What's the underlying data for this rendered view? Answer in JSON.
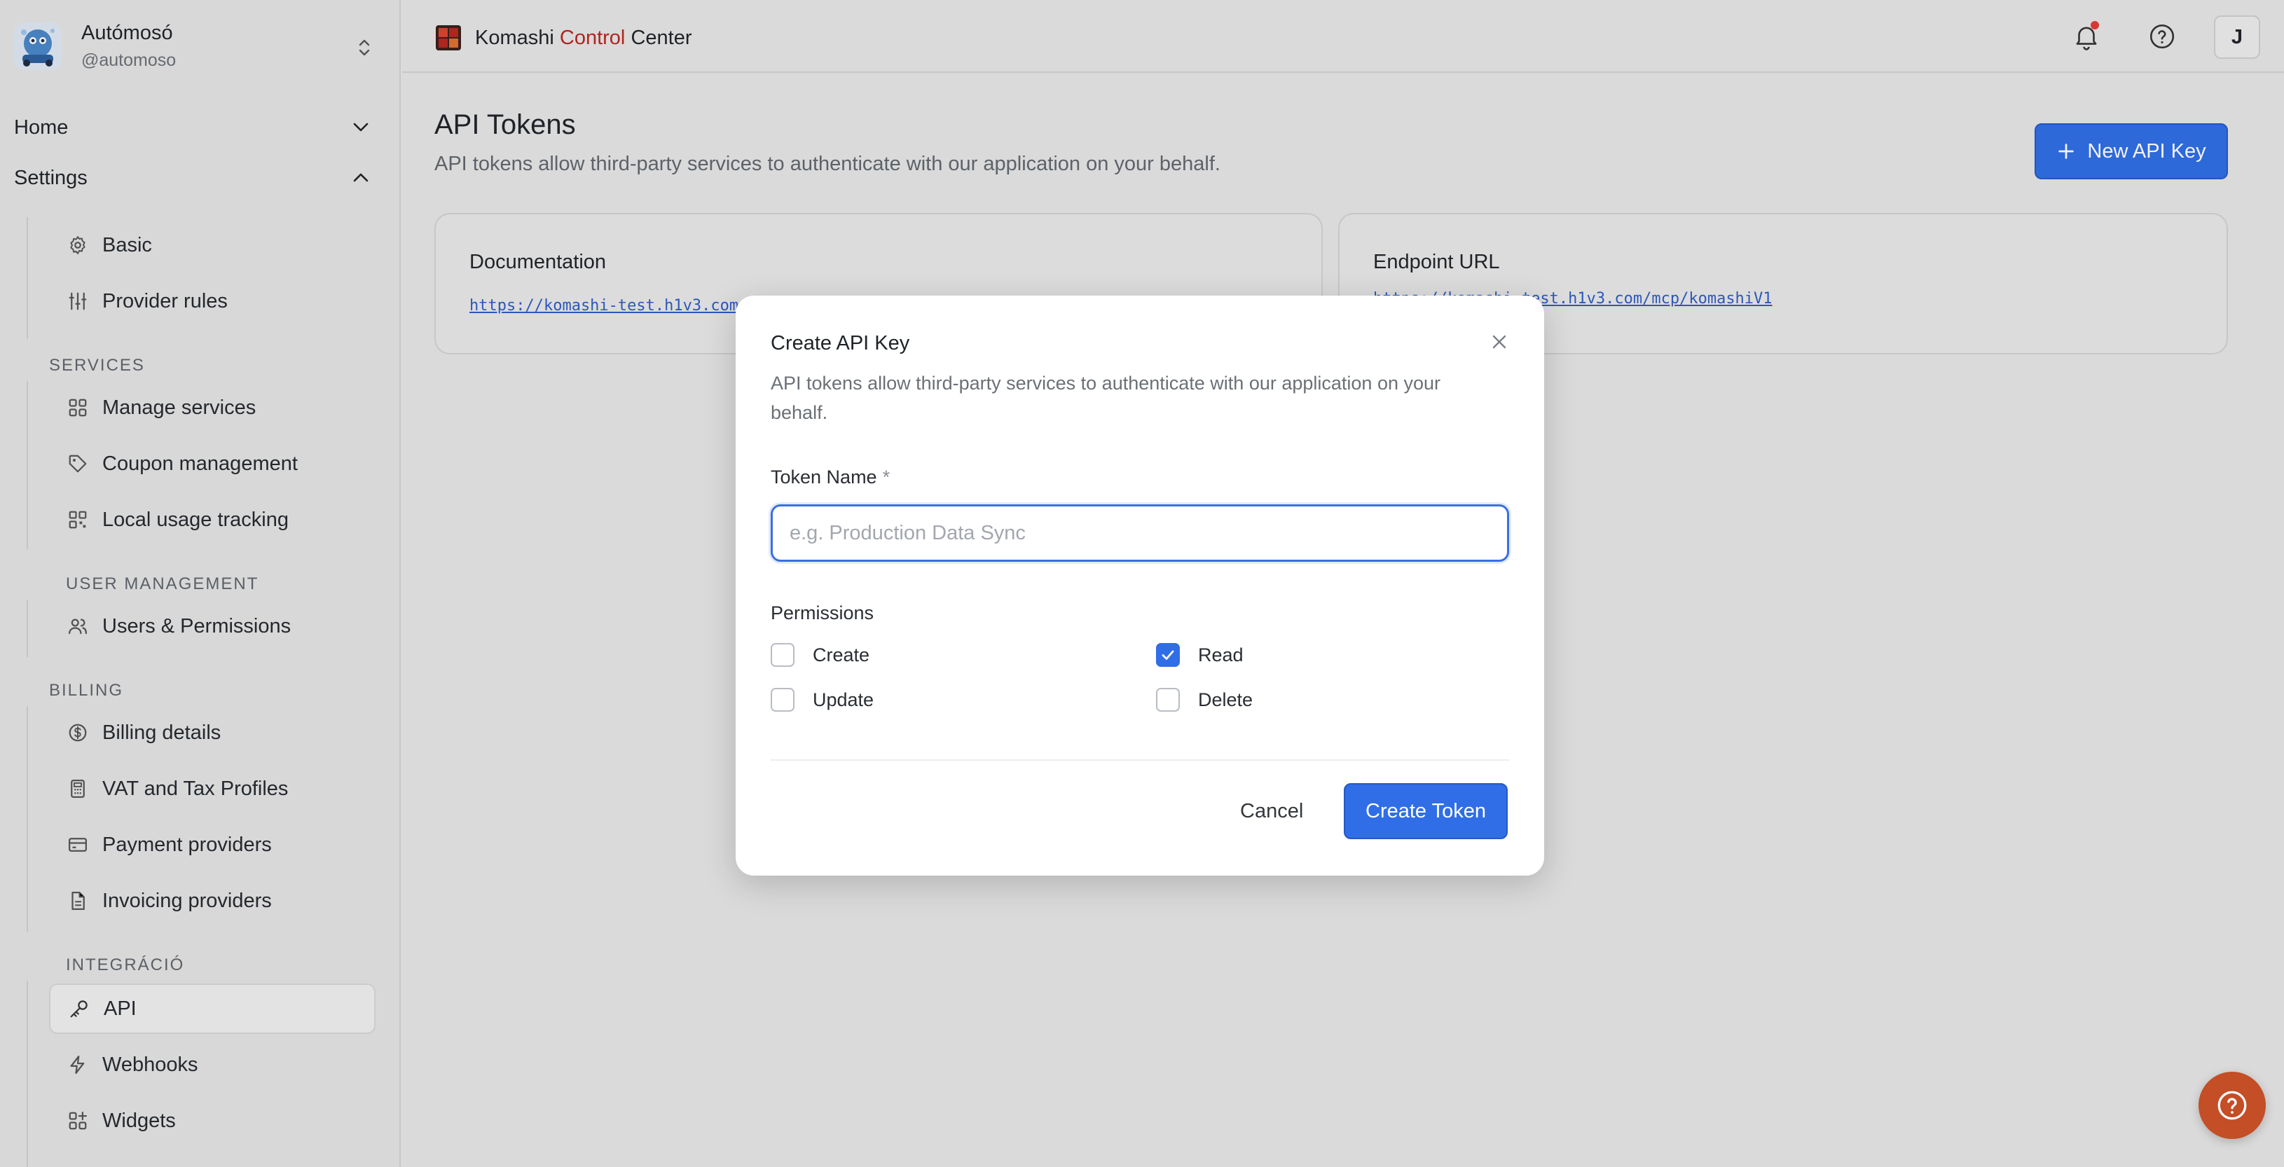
{
  "org": {
    "name": "Autómosó",
    "handle": "@automoso"
  },
  "sidebar": {
    "home_label": "Home",
    "settings_label": "Settings",
    "items_top": [
      {
        "label": "Basic",
        "icon": "gear-icon"
      },
      {
        "label": "Provider rules",
        "icon": "sliders-icon"
      }
    ],
    "sections": [
      {
        "title": "SERVICES",
        "items": [
          {
            "label": "Manage services",
            "icon": "grid-icon"
          },
          {
            "label": "Coupon management",
            "icon": "tag-icon"
          },
          {
            "label": "Local usage tracking",
            "icon": "qr-icon"
          }
        ]
      },
      {
        "title": "USER MANAGEMENT",
        "items": [
          {
            "label": "Users & Permissions",
            "icon": "users-icon"
          }
        ]
      },
      {
        "title": "BILLING",
        "items": [
          {
            "label": "Billing details",
            "icon": "dollar-circle-icon"
          },
          {
            "label": "VAT and Tax Profiles",
            "icon": "calculator-icon"
          },
          {
            "label": "Payment providers",
            "icon": "credit-card-icon"
          },
          {
            "label": "Invoicing providers",
            "icon": "file-icon"
          }
        ]
      },
      {
        "title": "INTEGRÁCIÓ",
        "items": [
          {
            "label": "API",
            "icon": "key-icon",
            "active": true
          },
          {
            "label": "Webhooks",
            "icon": "bolt-icon"
          },
          {
            "label": "Widgets",
            "icon": "widgets-icon"
          }
        ]
      }
    ]
  },
  "topbar": {
    "brand_part1": "Komashi",
    "brand_part2": "Control",
    "brand_part3": "Center",
    "avatar_initial": "J",
    "brand_red": "#b8261f"
  },
  "page": {
    "title": "API Tokens",
    "subtitle": "API tokens allow third-party services to authenticate with our application on your behalf.",
    "new_button": "New API Key",
    "cards": [
      {
        "title": "Documentation",
        "link": "https://komashi-test.h1v3.com/"
      },
      {
        "title": "Endpoint URL",
        "link": "https://komashi-test.h1v3.com/mcp/komashiV1"
      }
    ]
  },
  "modal": {
    "title": "Create API Key",
    "description": "API tokens allow third-party services to authenticate with our application on your behalf.",
    "field_label": "Token Name",
    "required_mark": "*",
    "placeholder": "e.g. Production Data Sync",
    "value": "",
    "permissions_label": "Permissions",
    "permissions": [
      {
        "label": "Create",
        "checked": false
      },
      {
        "label": "Read",
        "checked": true
      },
      {
        "label": "Update",
        "checked": false
      },
      {
        "label": "Delete",
        "checked": false
      }
    ],
    "cancel": "Cancel",
    "submit": "Create Token"
  },
  "colors": {
    "accent": "#2f6ee6",
    "help_fab": "#c44e25"
  }
}
